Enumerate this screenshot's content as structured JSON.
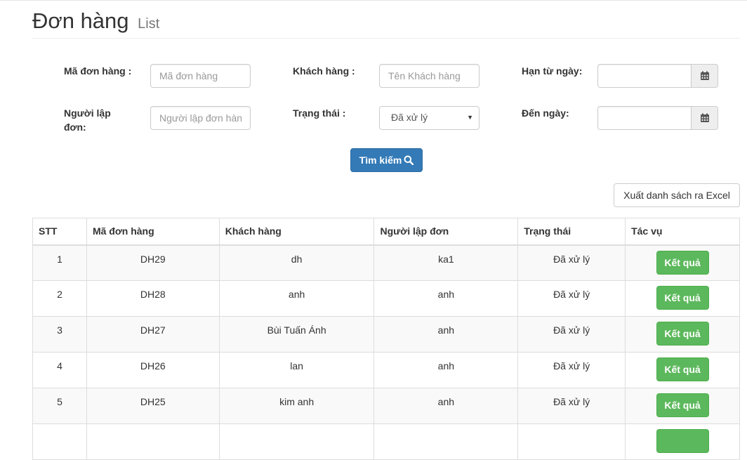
{
  "page": {
    "title": "Đơn hàng",
    "subtitle": "List"
  },
  "filters": {
    "order_code": {
      "label": "Mã đơn hàng :",
      "placeholder": "Mã đơn hàng",
      "value": ""
    },
    "customer": {
      "label": "Khách hàng :",
      "placeholder": "Tên Khách hàng",
      "value": ""
    },
    "from_date": {
      "label": "Hạn từ ngày:",
      "value": ""
    },
    "creator": {
      "label": "Người lập đơn:",
      "placeholder": "Người lập đơn hàng",
      "value": ""
    },
    "status": {
      "label": "Trạng thái :",
      "selected": "Đã xử lý"
    },
    "to_date": {
      "label": "Đến ngày:",
      "value": ""
    },
    "search_label": "Tìm kiếm"
  },
  "export_label": "Xuất danh sách ra Excel",
  "table": {
    "headers": [
      "STT",
      "Mã đơn hàng",
      "Khách hàng",
      "Người lập đơn",
      "Trạng thái",
      "Tác vụ"
    ],
    "rows": [
      {
        "stt": "1",
        "code": "DH29",
        "customer": "dh",
        "creator": "ka1",
        "status": "Đã xử lý",
        "action": "Kết quả"
      },
      {
        "stt": "2",
        "code": "DH28",
        "customer": "anh",
        "creator": "anh",
        "status": "Đã xử lý",
        "action": "Kết quả"
      },
      {
        "stt": "3",
        "code": "DH27",
        "customer": "Bùi Tuấn Ánh",
        "creator": "anh",
        "status": "Đã xử lý",
        "action": "Kết quả"
      },
      {
        "stt": "4",
        "code": "DH26",
        "customer": "lan",
        "creator": "anh",
        "status": "Đã xử lý",
        "action": "Kết quả"
      },
      {
        "stt": "5",
        "code": "DH25",
        "customer": "kim anh",
        "creator": "anh",
        "status": "Đã xử lý",
        "action": "Kết quả"
      }
    ]
  },
  "icons": {
    "search": "search-icon",
    "calendar": "calendar-icon",
    "dropdown": "caret-down-icon"
  },
  "colors": {
    "primary": "#337ab7",
    "success": "#5cb85c"
  }
}
